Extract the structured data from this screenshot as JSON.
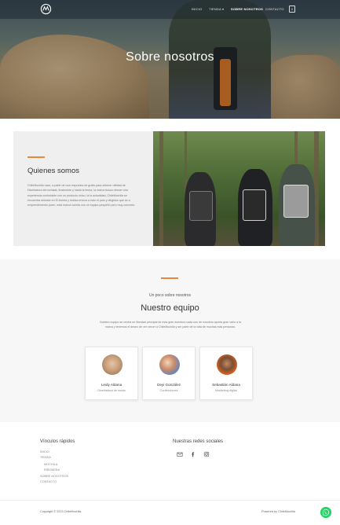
{
  "header": {
    "logo_alt": "ChileMochila logo",
    "nav": [
      {
        "label": "INICIO"
      },
      {
        "label": "TIENDA",
        "has_dropdown": true
      },
      {
        "label": "SOBRE NOSOTROS",
        "active": true
      },
      {
        "label": "CONTACTO"
      }
    ],
    "cart_count": "0"
  },
  "hero": {
    "title": "Sobre nosotros"
  },
  "about": {
    "title": "Quienes somos",
    "text": "ChileMochila nace, a partir de una respuesta de gratis para obtener utilidad de Diseñadora derrochada, finalmente y hasta la fecha, la marca busca ofrecer una experiencia confortable con un producto único, la la actualidad, ChileMochila se encuentra ubicado en El Arrieta y realiza envíos a todo el país y dirigidos que se a emprendimiento joven, esta marca cuenta con un equipo pequeño pero muy concreto."
  },
  "team": {
    "kicker": "Un poco sobre nosotros",
    "title": "Nuestro equipo",
    "text": "Nuestro equipo se centra en liberdad principal de esta gran aventura cada uno de nosotros aporta gran valor a la marca y tenemos el deseo de ver crecer a ChileMochila y ser parte de la vida de muchas más personas.",
    "members": [
      {
        "name": "Leidy Aldana",
        "role": "Diseñadora de moda"
      },
      {
        "name": "Deyi González",
        "role": "Confecciones"
      },
      {
        "name": "Sebastián Aldana",
        "role": "Marketing digital"
      }
    ]
  },
  "footer": {
    "links_title": "Vínculos rápidos",
    "links": [
      {
        "label": "INICIO"
      },
      {
        "label": "TIENDA"
      },
      {
        "label": "MOCHILA"
      },
      {
        "label": "RIÑONERA"
      },
      {
        "label": "SOBRE NOSOTROS"
      },
      {
        "label": "CONTACTO"
      }
    ],
    "social_title": "Nuestras redes sociales",
    "social_icons": [
      "email-icon",
      "facebook-icon",
      "instagram-icon"
    ],
    "copyright": "Copyright © 2023 ChileMochila",
    "powered": "Powered by ChileMochila"
  },
  "colors": {
    "accent": "#e7893a",
    "whatsapp": "#25d366"
  }
}
